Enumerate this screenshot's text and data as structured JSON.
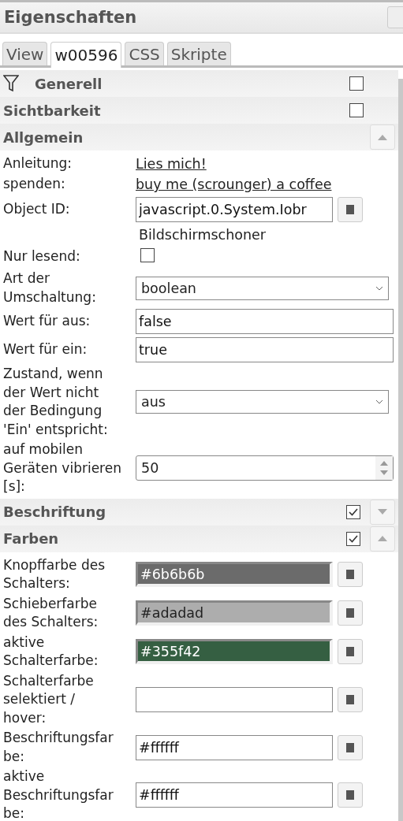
{
  "panel": {
    "title": "Eigenschaften"
  },
  "tabs": [
    {
      "label": "View",
      "selected": false
    },
    {
      "label": "w00596",
      "selected": true
    },
    {
      "label": "CSS",
      "selected": false
    },
    {
      "label": "Skripte",
      "selected": false
    }
  ],
  "sections": [
    {
      "title": "Generell",
      "filter": true,
      "checked": false
    },
    {
      "title": "Sichtbarkeit",
      "checked": false
    },
    {
      "title": "Allgemein",
      "expanded": true,
      "rows": [
        {
          "kind": "link",
          "label": "Anleitung:",
          "value": "Lies mich!"
        },
        {
          "kind": "link",
          "label": "spenden:",
          "value": "buy me (scrounger) a coffee"
        },
        {
          "kind": "object",
          "label": "Object ID:",
          "value": "javascript.0.System.Iobr",
          "note": "Bildschirmschoner"
        },
        {
          "kind": "checkbox",
          "label": "Nur lesend:",
          "checked": false
        },
        {
          "kind": "select",
          "label": "Art der Umschaltung:",
          "value": "boolean"
        },
        {
          "kind": "text",
          "label": "Wert für aus:",
          "value": "false"
        },
        {
          "kind": "text",
          "label": "Wert für ein:",
          "value": "true"
        },
        {
          "kind": "select",
          "label": "Zustand, wenn der Wert nicht der Bedingung 'Ein' entspricht:",
          "value": "aus"
        },
        {
          "kind": "number",
          "label": "auf mobilen Geräten vibrieren [s]:",
          "value": "50"
        }
      ]
    },
    {
      "title": "Beschriftung",
      "checked": true,
      "expanded": false
    },
    {
      "title": "Farben",
      "checked": true,
      "expanded": true,
      "rows": [
        {
          "kind": "color",
          "label": "Knopffarbe des Schalters:",
          "value": "#6b6b6b",
          "color": "#6b6b6b"
        },
        {
          "kind": "color",
          "label": "Schieberfarbe des Schalters:",
          "value": "#adadad",
          "color": "#adadad"
        },
        {
          "kind": "color",
          "label": "aktive Schalterfarbe:",
          "value": "#355f42",
          "color": "#355f42"
        },
        {
          "kind": "color",
          "label": "Schalterfarbe selektiert / hover:"
        },
        {
          "kind": "color",
          "label": "Beschriftungsfarbe:",
          "value": "#ffffff"
        },
        {
          "kind": "color",
          "label": "aktive Beschriftungsfarbe:",
          "value": "#ffffff"
        }
      ]
    }
  ]
}
